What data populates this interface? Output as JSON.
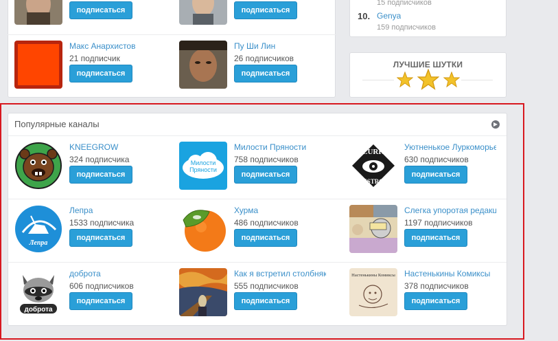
{
  "top_users": [
    {
      "name": "",
      "count": "",
      "button": "подписаться"
    },
    {
      "name": "",
      "count": "",
      "button": "подписаться"
    },
    {
      "name": "Макс Анархистов",
      "count": "21 подписчик",
      "button": "подписаться"
    },
    {
      "name": "Пу Ши Лин",
      "count": "26 подписчиков",
      "button": "подписаться"
    }
  ],
  "rating": {
    "prev_count": "15 подписчиков",
    "item": {
      "rank": "10.",
      "name": "Genya",
      "count": "159 подписчиков"
    }
  },
  "jokes": {
    "title": "ЛУЧШИЕ ШУТКИ",
    "star_color": "#f2c22a"
  },
  "popular_channels": {
    "title": "Популярные каналы",
    "channels": [
      {
        "name": "KNEEGROW",
        "count": "324 подписчика",
        "button": "подписаться",
        "icon": "bear-face-icon"
      },
      {
        "name": "Милости Пряности",
        "count": "758 подписчиков",
        "button": "подписаться",
        "icon": "cloud-logo-icon",
        "logo_text_line1": "Милости",
        "logo_text_line2": "Пряности"
      },
      {
        "name": "Уютненькое Луркоморье",
        "count": "630 подписчиков",
        "button": "подписаться",
        "icon": "lurk-destroy-eye-icon",
        "logo_text_top": "LURK",
        "logo_text_bottom": "DESTROY"
      },
      {
        "name": "Лепра",
        "count": "1533 подписчика",
        "button": "подписаться",
        "icon": "unicorn-logo-icon",
        "logo_text": "Лепра"
      },
      {
        "name": "Хурма",
        "count": "486 подписчиков",
        "button": "подписаться",
        "icon": "persimmon-icon"
      },
      {
        "name": "Слегка упоротая редакция",
        "count": "1197 подписчиков",
        "button": "подписаться",
        "icon": "comic-collage-icon"
      },
      {
        "name": "доброта",
        "count": "606 подписчиков",
        "button": "подписаться",
        "icon": "raccoon-icon",
        "logo_text": "доброта"
      },
      {
        "name": "Как я встретил столбняк",
        "count": "555 подписчиков",
        "button": "подписаться",
        "icon": "scream-painting-icon"
      },
      {
        "name": "Настенькины Комиксы",
        "count": "378 подписчиков",
        "button": "подписаться",
        "icon": "comic-sketch-icon",
        "logo_text": "Настенькины Комиксы"
      }
    ]
  },
  "colors": {
    "accent": "#2a9fd8",
    "link": "#3a8fc9",
    "highlight_frame": "#d8181f"
  }
}
